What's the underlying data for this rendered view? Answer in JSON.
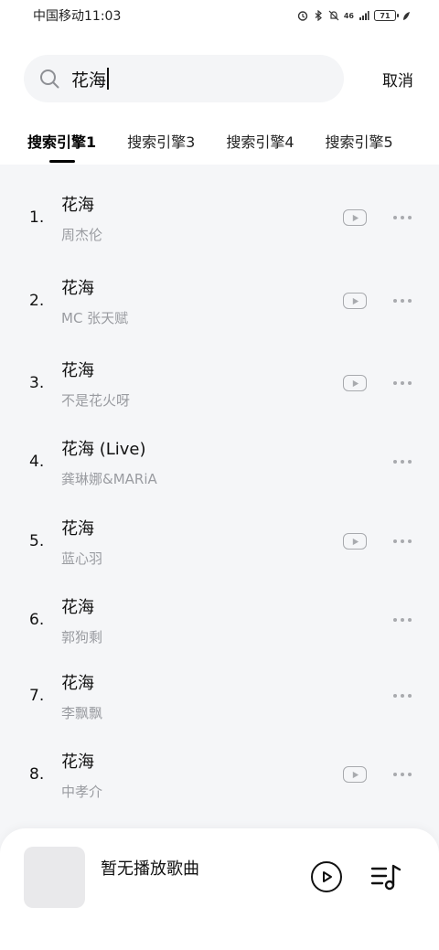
{
  "status_bar": {
    "carrier_time": "中国移动11:03",
    "network": "46",
    "battery": "71"
  },
  "search": {
    "query": "花海",
    "cancel_label": "取消"
  },
  "tabs": [
    {
      "label": "搜索引擎1",
      "active": true
    },
    {
      "label": "搜索引擎3",
      "active": false
    },
    {
      "label": "搜索引擎4",
      "active": false
    },
    {
      "label": "搜索引擎5",
      "active": false
    }
  ],
  "songs": [
    {
      "index": "1.",
      "title": "花海",
      "artist": "周杰伦",
      "has_mv": true
    },
    {
      "index": "2.",
      "title": "花海",
      "artist": "MC 张天赋",
      "has_mv": true
    },
    {
      "index": "3.",
      "title": "花海",
      "artist": "不是花火呀",
      "has_mv": true
    },
    {
      "index": "4.",
      "title": "花海 (Live)",
      "artist": "龚琳娜&MARiA",
      "has_mv": false
    },
    {
      "index": "5.",
      "title": "花海",
      "artist": "蓝心羽",
      "has_mv": true
    },
    {
      "index": "6.",
      "title": "花海",
      "artist": "郭狗剩",
      "has_mv": false
    },
    {
      "index": "7.",
      "title": "花海",
      "artist": "李飘飘",
      "has_mv": false
    },
    {
      "index": "8.",
      "title": "花海",
      "artist": "中孝介",
      "has_mv": true
    }
  ],
  "player": {
    "now_playing": "暂无播放歌曲"
  },
  "icons": {
    "search": "search-icon",
    "mv": "mv-play-icon",
    "more": "more-icon",
    "play": "play-icon",
    "playlist": "playlist-icon"
  },
  "colors": {
    "list_background": "#f5f6f8",
    "secondary_text": "#9a9ca1",
    "icon_gray": "#a8aaae"
  }
}
